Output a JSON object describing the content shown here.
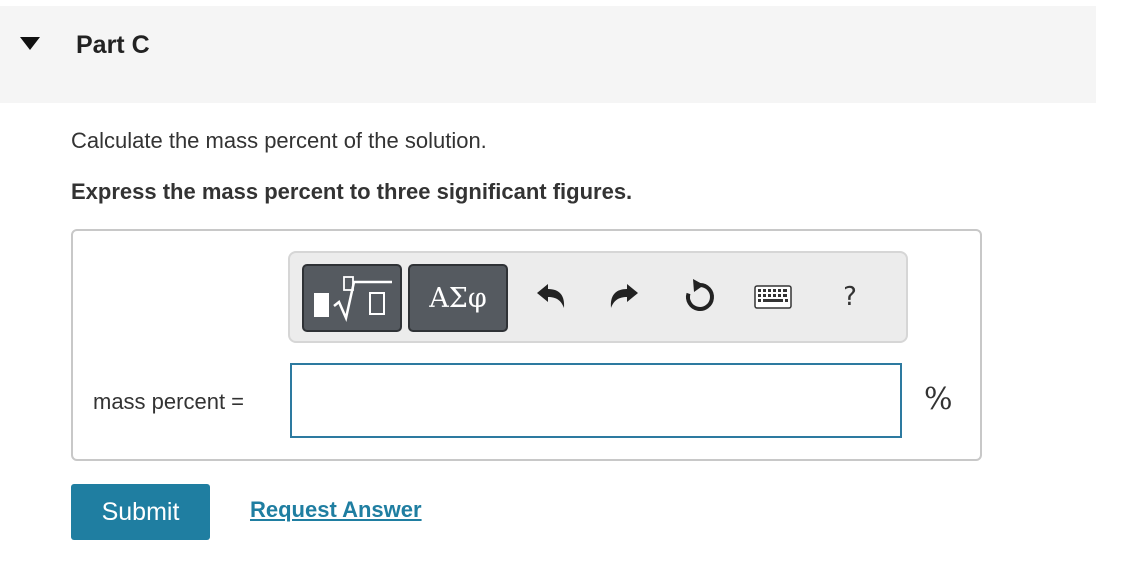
{
  "part": {
    "title": "Part C",
    "toggle_icon": "triangle-down-icon"
  },
  "question": {
    "text": "Calculate the mass percent of the solution.",
    "instruction": "Express the mass percent to three significant figures."
  },
  "toolbar": {
    "templates_icon": "templates-sqrt-icon",
    "greek_label": "ΑΣφ",
    "undo_icon": "undo-icon",
    "redo_icon": "redo-icon",
    "reset_icon": "reset-icon",
    "keyboard_icon": "keyboard-icon",
    "help_label": "?"
  },
  "answer": {
    "label": "mass percent =",
    "value": "",
    "unit": "%"
  },
  "actions": {
    "submit_label": "Submit",
    "request_answer_label": "Request Answer"
  },
  "colors": {
    "accent": "#1f7ea1",
    "input_border": "#2d7aa0",
    "header_bg": "#f5f5f5",
    "toolbar_btn": "#555a60"
  }
}
